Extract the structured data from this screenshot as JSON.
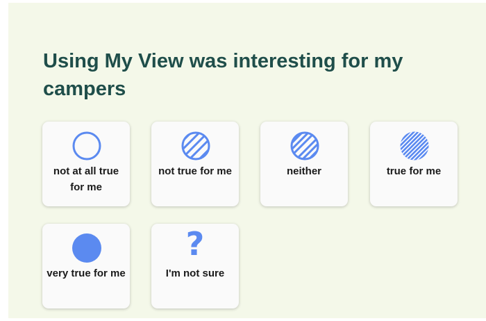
{
  "question": "Using My View was interesting for my campers",
  "accent_color": "#5b8af0",
  "title_color": "#1f4e4a",
  "options": [
    {
      "label": "not at all true for me",
      "icon": "empty-circle-icon"
    },
    {
      "label": "not true for me",
      "icon": "sparse-hatched-circle-icon"
    },
    {
      "label": "neither",
      "icon": "hatched-circle-icon"
    },
    {
      "label": "true for me",
      "icon": "dense-hatched-circle-icon"
    },
    {
      "label": "very true for me",
      "icon": "filled-circle-icon"
    },
    {
      "label": "I'm not sure",
      "icon": "question-mark-icon",
      "glyph": "?"
    }
  ]
}
